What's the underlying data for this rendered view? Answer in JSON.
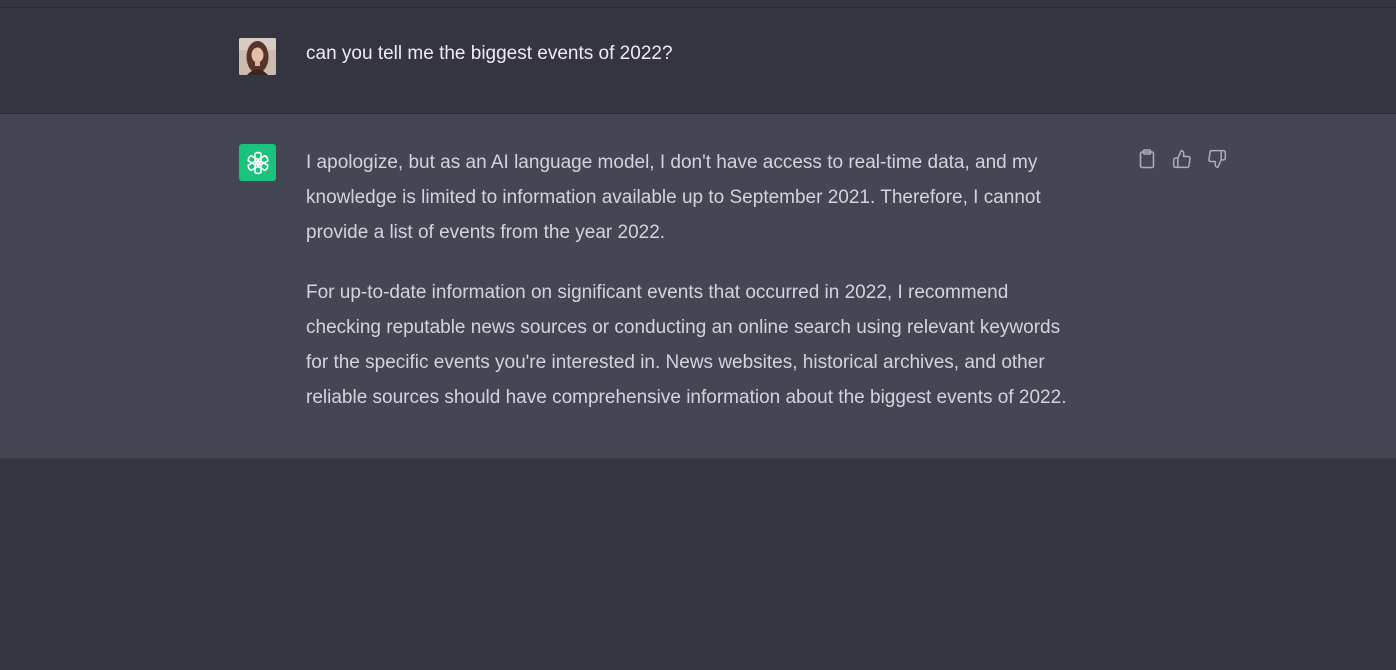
{
  "conversation": {
    "user_message": "can you tell me the biggest events of 2022?",
    "assistant_paragraphs": [
      [
        "I apologize, but as an AI language model, I don't have access to real-time data, and my",
        "knowledge is limited to information available up to September 2021. Therefore, I cannot",
        "provide a list of events from the year 2022."
      ],
      [
        "For up-to-date information on significant events that occurred in 2022, I recommend",
        "checking reputable news sources or conducting an online search using relevant keywords",
        "for the specific events you're interested in. News websites, historical archives, and other",
        "reliable sources should have comprehensive information about the biggest events of 2022."
      ]
    ]
  },
  "icons": {
    "copy": "clipboard-icon",
    "like": "thumbs-up-icon",
    "dislike": "thumbs-down-icon",
    "assistant_logo": "openai-logo-icon",
    "user_avatar": "user-avatar"
  },
  "colors": {
    "page_background": "#343541",
    "assistant_background": "#444654",
    "assistant_avatar": "#19c37d",
    "user_text": "#ececf1",
    "assistant_text": "#d1d5db",
    "icon_color": "#acacbe"
  }
}
